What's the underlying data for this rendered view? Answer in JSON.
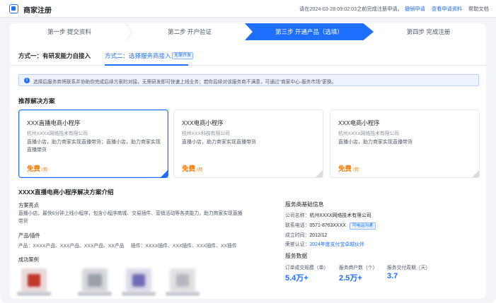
{
  "header": {
    "title": "商家注册",
    "notice": "请在2024-03-28 09:02:03之前完成注册申请。",
    "cancel_link": "撤销申请",
    "view_link": "查看申请资料",
    "help": "帮助文档"
  },
  "steps": [
    {
      "label": "第一步 提交资料"
    },
    {
      "label": "第二步 开户验证"
    },
    {
      "label": "第三步 开通产品（选填）"
    },
    {
      "label": "第四步 完成注册"
    }
  ],
  "tabs": {
    "first": "方式一：有研发能力自接入",
    "second": "方式二：选择服务商接入",
    "badge": "无需开发"
  },
  "banner": "选择后服务商将联系并协助你完成后续方案的对接，无需研发即可快速上线业务；若你后续对该服务商不满意，可通过\"商家中心-服务市场\"更换。",
  "recommend_title": "推荐解决方案",
  "solutions": [
    {
      "name": "XXX直播电商小程序",
      "company": "杭州XXXX网络技术有限公司",
      "desc": "直播小店，助力商家实现直播带货；直播小店，助力商家实现直播带货",
      "price": "免费",
      "unit": "/月"
    },
    {
      "name": "XXX电商小程序",
      "company": "杭州XXX科技有限公司",
      "desc": "直播小店，助力商家实现直播带货",
      "price": "免费",
      "unit": "/月"
    },
    {
      "name": "XXX电商小程序",
      "company": "杭州XXXX网络技术有限公司",
      "desc": "直播小店，助力商家实现直播带货",
      "price": "免费",
      "unit": "/月"
    }
  ],
  "detail": {
    "title": "XXXX直播电商小程序解决方案介绍",
    "highlights_label": "方案亮点",
    "highlights_text": "直播小店，最快5分钟上线小程序，包含小程序商城、交易插件、营销活动等各类能力，助力商家实现直播带货",
    "products_label": "产品/插件",
    "products_text": "产品：XXXX产品、XXX产品、XXX产品、XX产品",
    "plugins_text": "插件：XXXX插件、XXX插件、XXX插件、XX插件",
    "cases_label": "成功案例"
  },
  "provider": {
    "title": "服务商基础信息",
    "company_key": "公司名称：",
    "company_val": "杭州XXXX网络技术有限公司",
    "phone_key": "联系电话：",
    "phone_val": "0571-8763XXXX",
    "phone_tag": "可电话沟通",
    "since_key": "成立时间：",
    "since_val": "2012/12",
    "honor_key": "荣誉认证：",
    "honor_val": "2024年度支付宝卓越伙伴"
  },
  "stats": {
    "title": "服务数据",
    "items": [
      {
        "label": "订单成交规模（单）",
        "value": "5.4万+"
      },
      {
        "label": "服务商户数（个）",
        "value": "2.5万+"
      },
      {
        "label": "服务交付周期（天）",
        "value": "3.7"
      }
    ]
  },
  "colors": {
    "accent": "#1f6fff",
    "price": "#ff7a00"
  }
}
